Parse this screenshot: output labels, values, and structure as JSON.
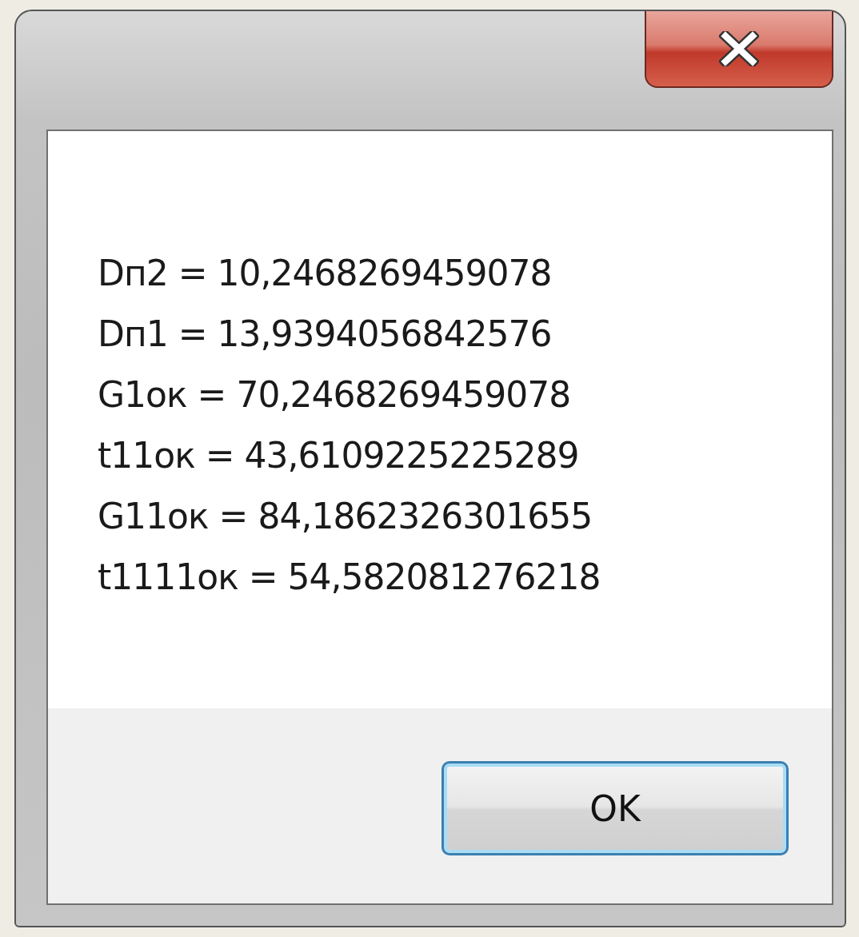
{
  "dialog": {
    "message_lines": [
      "Dп2 = 10,2468269459078",
      "Dп1 = 13,9394056842576",
      "G1ок = 70,2468269459078",
      "t11ок = 43,6109225225289",
      "G11ок = 84,1862326301655",
      "t1111ок = 54,582081276218"
    ],
    "buttons": [
      {
        "label": "OK",
        "selected": true
      }
    ]
  }
}
